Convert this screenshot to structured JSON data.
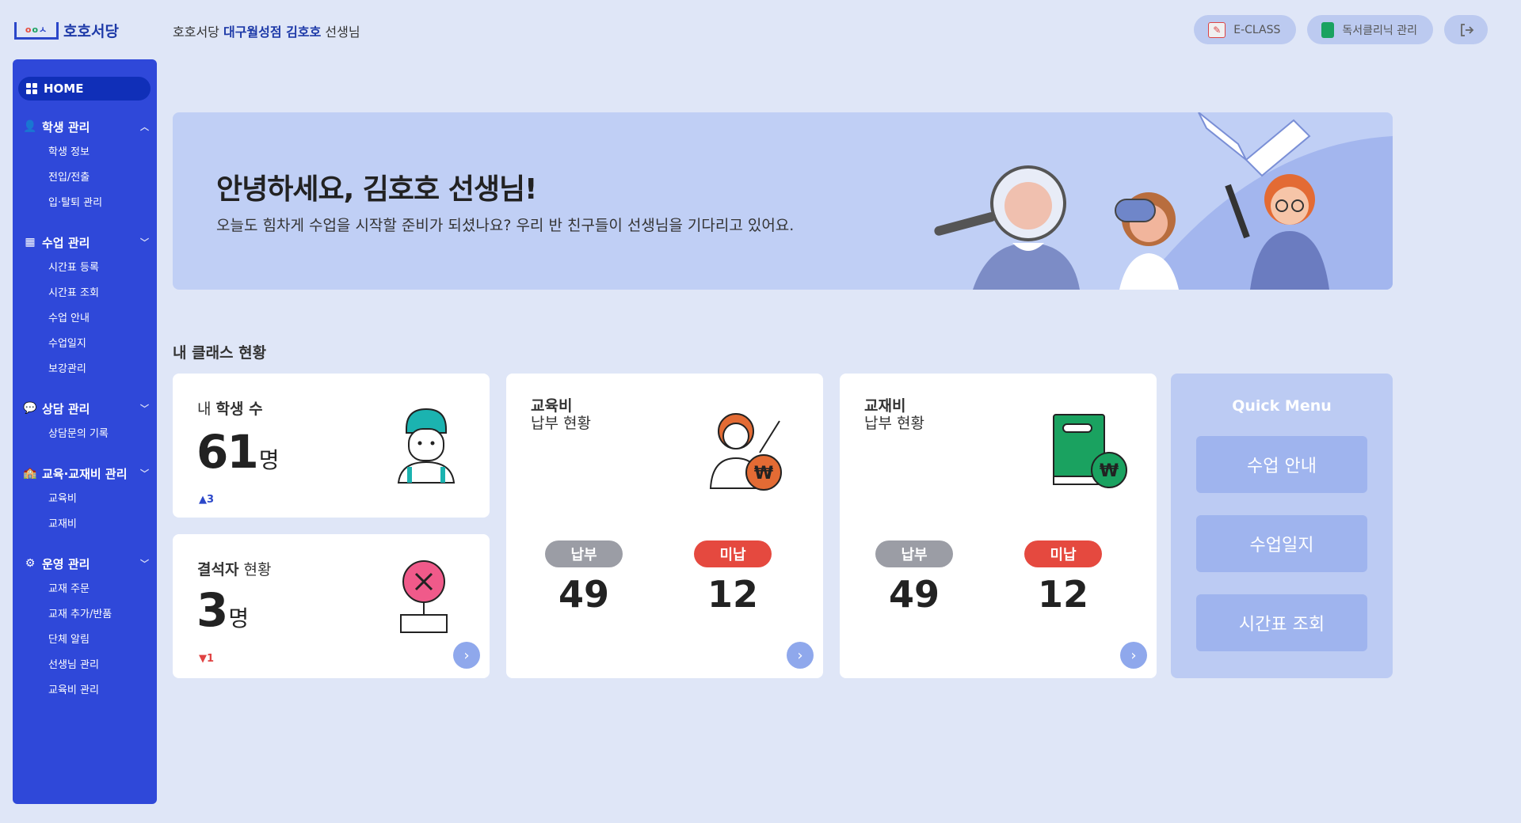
{
  "header": {
    "logo_text": "호호서당",
    "greeting_prefix": "호호서당",
    "greeting_branch": "대구월성점 김호호",
    "greeting_suffix": "선생님",
    "eclass_label": "E-CLASS",
    "clinic_label": "독서클리닉 관리"
  },
  "sidebar": {
    "home_label": "HOME",
    "sections": [
      {
        "label": "학생 관리",
        "items": [
          "학생 정보",
          "전입/전출",
          "입·탈퇴 관리"
        ]
      },
      {
        "label": "수업 관리",
        "items": [
          "시간표 등록",
          "시간표 조회",
          "수업 안내",
          "수업일지",
          "보강관리"
        ]
      },
      {
        "label": "상담 관리",
        "items": [
          "상담문의 기록"
        ]
      },
      {
        "label": "교육·교재비 관리",
        "items": [
          "교육비",
          "교재비"
        ]
      },
      {
        "label": "운영 관리",
        "items": [
          "교재 주문",
          "교재 추가/반품",
          "단체 알림",
          "선생님 관리",
          "교육비 관리"
        ]
      }
    ]
  },
  "banner": {
    "title": "안녕하세요, 김호호 선생님!",
    "subtitle": "오늘도 힘차게 수업을 시작할 준비가 되셨나요? 우리 반 친구들이 선생님을 기다리고 있어요."
  },
  "class_status": {
    "title": "내 클래스 현황",
    "students": {
      "label_prefix": "내",
      "label_bold": "학생 수",
      "count": "61",
      "unit": "명",
      "delta": "▲3"
    },
    "absent": {
      "label_bold": "결석자",
      "label_suffix": "현황",
      "count": "3",
      "unit": "명",
      "delta": "▼1"
    },
    "tuition": {
      "title": "교육비",
      "subtitle": "납부 현황",
      "paid_label": "납부",
      "unpaid_label": "미납",
      "paid": "49",
      "unpaid": "12"
    },
    "books": {
      "title": "교재비",
      "subtitle": "납부 현황",
      "paid_label": "납부",
      "unpaid_label": "미납",
      "paid": "49",
      "unpaid": "12"
    }
  },
  "quick_menu": {
    "title": "Quick Menu",
    "items": [
      "수업 안내",
      "수업일지",
      "시간표 조회"
    ]
  },
  "colors": {
    "sidebar": "#2f48d9",
    "accent": "#1e3aa8",
    "paid": "#9b9da5",
    "unpaid": "#e5493f"
  }
}
